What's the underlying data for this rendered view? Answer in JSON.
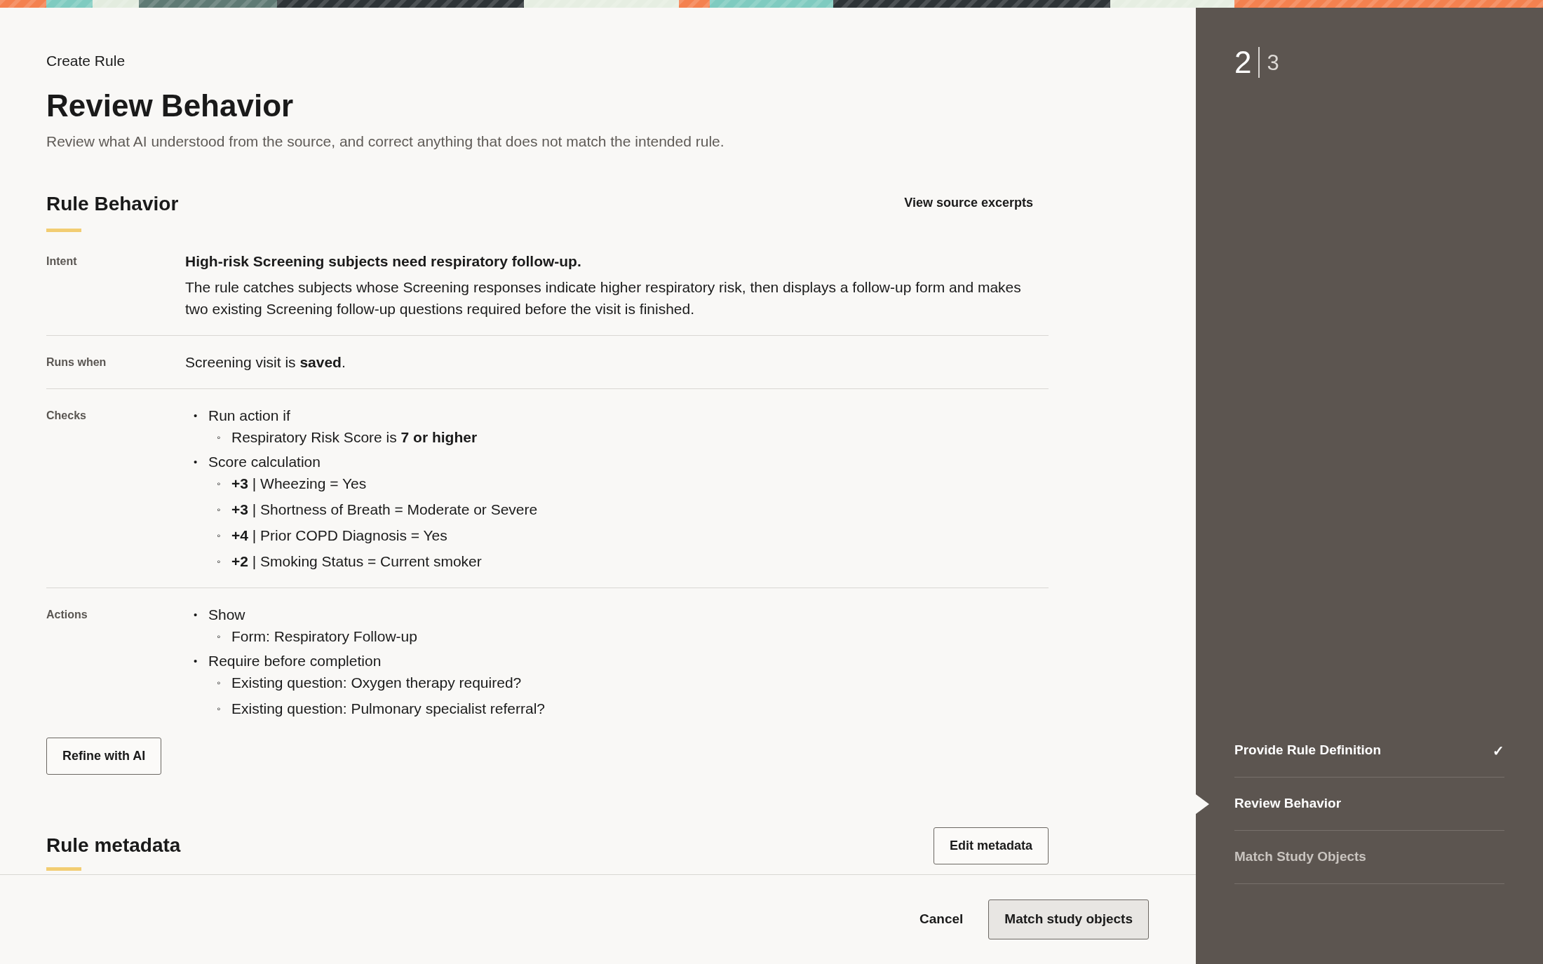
{
  "breadcrumb": "Create Rule",
  "title": "Review Behavior",
  "subtitle": "Review what AI understood from the source, and correct anything that does not match the intended rule.",
  "section": {
    "title": "Rule Behavior",
    "link": "View source excerpts"
  },
  "rows": [
    {
      "label": "Intent",
      "kind": "intent",
      "heading": "High-risk Screening subjects need respiratory follow-up.",
      "text": "The rule catches subjects whose Screening responses indicate higher respiratory risk, then displays a follow-up form and makes two existing Screening follow-up questions required before the visit is finished."
    },
    {
      "label": "Runs when",
      "kind": "text",
      "text": "Screening visit is **saved**."
    },
    {
      "label": "Checks",
      "kind": "list",
      "items": [
        {
          "marker": "•",
          "text": "Run action if",
          "children": [
            {
              "marker": "◦",
              "text": "Respiratory Risk Score is **7 or higher**"
            }
          ]
        },
        {
          "marker": "•",
          "text": "Score calculation",
          "children": [
            {
              "marker": "◦",
              "text": "**+3** | Wheezing = Yes"
            },
            {
              "marker": "◦",
              "text": "**+3** | Shortness of Breath = Moderate or Severe"
            },
            {
              "marker": "◦",
              "text": "**+4** | Prior COPD Diagnosis = Yes"
            },
            {
              "marker": "◦",
              "text": "**+2** | Smoking Status = Current smoker"
            }
          ]
        }
      ]
    },
    {
      "label": "Actions",
      "kind": "list",
      "items": [
        {
          "marker": "•",
          "text": "Show",
          "children": [
            {
              "marker": "◦",
              "text": "Form: Respiratory Follow-up"
            }
          ]
        },
        {
          "marker": "•",
          "text": "Require before completion",
          "children": [
            {
              "marker": "◦",
              "text": "Existing question: Oxygen therapy required?"
            },
            {
              "marker": "◦",
              "text": "Existing question: Pulmonary specialist referral?"
            }
          ]
        }
      ]
    }
  ],
  "refine_button": "Refine with AI",
  "metadata": {
    "title": "Rule metadata",
    "button": "Edit metadata"
  },
  "footer": {
    "cancel": "Cancel",
    "primary": "Match study objects"
  },
  "progress": {
    "current": "2",
    "total": "3"
  },
  "steps": [
    {
      "label": "Provide Rule Definition",
      "completed": true,
      "selected": false,
      "check": "✓"
    },
    {
      "label": "Review Behavior",
      "completed": false,
      "selected": true
    },
    {
      "label": "Match Study Objects",
      "completed": false,
      "selected": false
    }
  ]
}
